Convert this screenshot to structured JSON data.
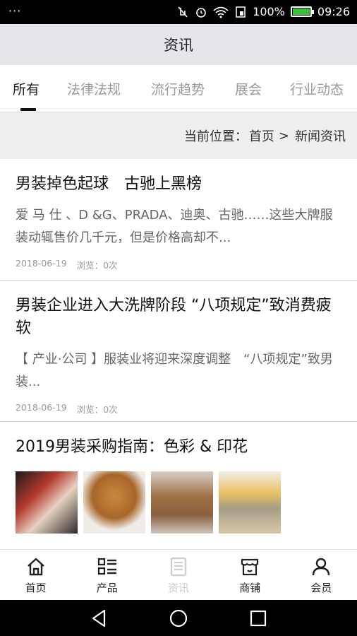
{
  "status": {
    "menu_dots": "···",
    "battery_percent": "100%",
    "time": "09:26"
  },
  "header": {
    "title": "资讯"
  },
  "tabs": [
    {
      "label": "所有",
      "active": true
    },
    {
      "label": "法律法规",
      "active": false
    },
    {
      "label": "流行趋势",
      "active": false
    },
    {
      "label": "展会",
      "active": false
    },
    {
      "label": "行业动态",
      "active": false
    }
  ],
  "breadcrumb": {
    "prefix": "当前位置：",
    "home": "首页",
    "separator": ">",
    "current": "新闻资讯"
  },
  "articles": [
    {
      "title": "男装掉色起球　古驰上黑榜",
      "summary": "爱 马 仕 、D &G、PRADA、迪奥、古驰……这些大牌服装动辄售价几千元，但是价格高却不...",
      "date": "2018-06-19",
      "views": "浏览：0次"
    },
    {
      "title": "男装企业进入大洗牌阶段 “八项规定”致消费疲软",
      "summary": "【 产业·公司 】服装业将迎来深度调整　“八项规定”致男装...",
      "date": "2018-06-19",
      "views": "浏览：0次"
    },
    {
      "title": "2019男装采购指南：色彩 & 印花"
    }
  ],
  "bottom_nav": [
    {
      "label": "首页",
      "icon": "home-icon"
    },
    {
      "label": "产品",
      "icon": "grid-list-icon"
    },
    {
      "label": "资讯",
      "icon": "news-icon",
      "active": true
    },
    {
      "label": "商铺",
      "icon": "shop-icon"
    },
    {
      "label": "会员",
      "icon": "user-icon"
    }
  ]
}
